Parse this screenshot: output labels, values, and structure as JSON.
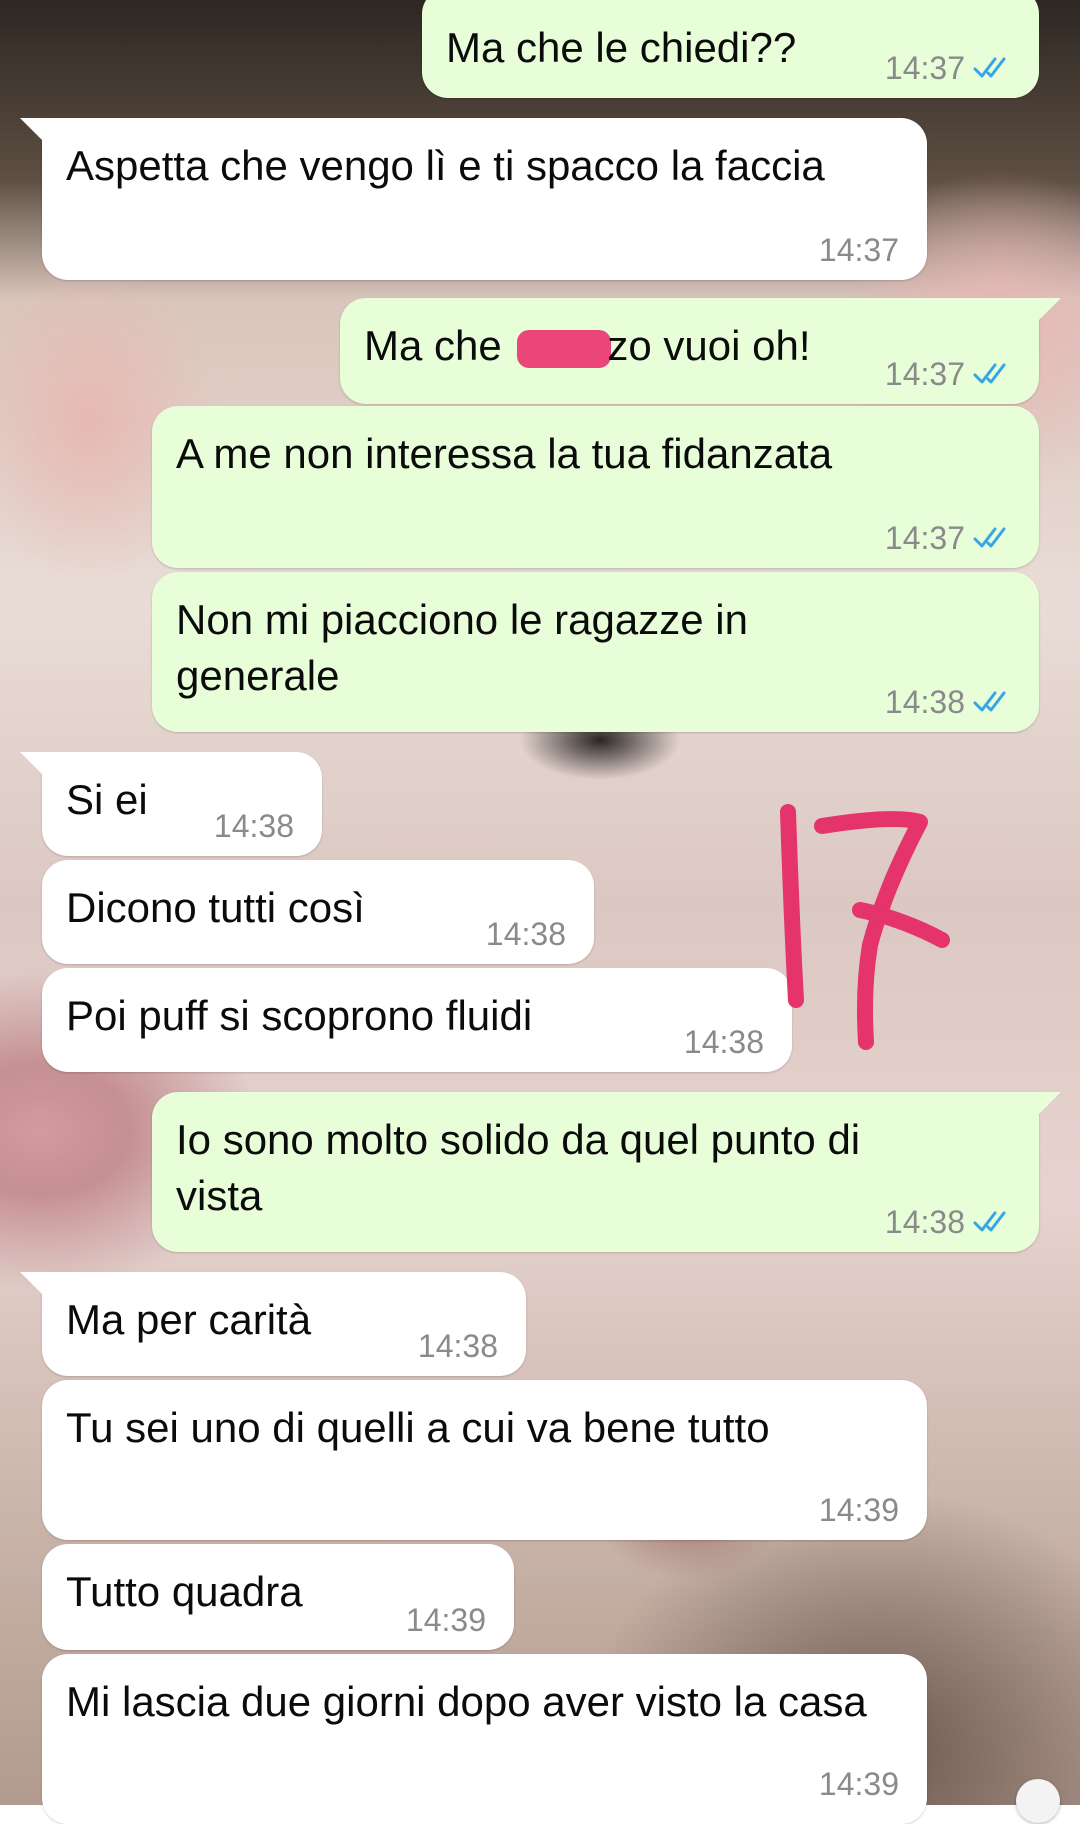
{
  "colors": {
    "outgoing_bubble": "#e7fed8",
    "incoming_bubble": "#ffffff",
    "timestamp": "#8a8a8a",
    "read_ticks": "#35a7e8",
    "censor_bar": "#ea4679",
    "annotation": "#e5336b"
  },
  "icons": {
    "read_receipt": "double-check-icon"
  },
  "messages": [
    {
      "direction": "outgoing",
      "text": "Ma che le chiedi??",
      "time": "14:37",
      "read": true
    },
    {
      "direction": "incoming",
      "text": "Aspetta che vengo lì e ti spacco la faccia",
      "time": "14:37"
    },
    {
      "direction": "outgoing",
      "text_before": "Ma che ",
      "text_after": "zo vuoi oh!",
      "censored": true,
      "time": "14:37",
      "read": true
    },
    {
      "direction": "outgoing",
      "text": "A me non interessa la tua fidanzata",
      "time": "14:37",
      "read": true
    },
    {
      "direction": "outgoing",
      "text": "Non mi piacciono le ragazze in generale",
      "time": "14:38",
      "read": true
    },
    {
      "direction": "incoming",
      "text": "Si ei",
      "time": "14:38"
    },
    {
      "direction": "incoming",
      "text": "Dicono tutti così",
      "time": "14:38"
    },
    {
      "direction": "incoming",
      "text": "Poi puff si scoprono fluidi",
      "time": "14:38"
    },
    {
      "direction": "outgoing",
      "text": "Io sono molto solido da quel punto di vista",
      "time": "14:38",
      "read": true
    },
    {
      "direction": "incoming",
      "text": "Ma per carità",
      "time": "14:38"
    },
    {
      "direction": "incoming",
      "text": "Tu sei uno di quelli a cui va bene tutto",
      "time": "14:39"
    },
    {
      "direction": "incoming",
      "text": "Tutto quadra",
      "time": "14:39"
    },
    {
      "direction": "incoming",
      "text": "Mi lascia due giorni dopo aver visto la casa",
      "time": "14:39"
    }
  ],
  "annotation": {
    "text": "17"
  }
}
